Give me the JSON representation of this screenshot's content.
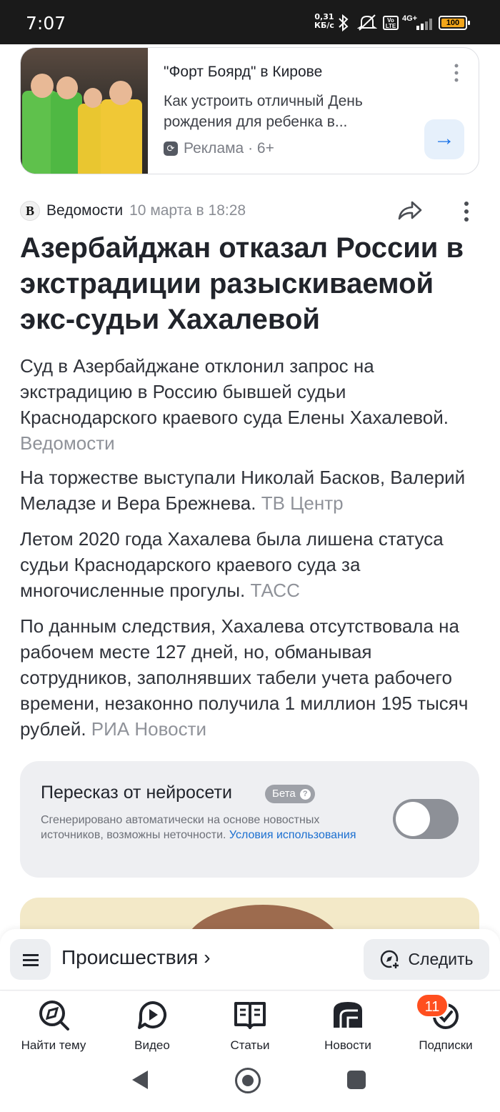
{
  "status_bar": {
    "time": "7:07",
    "rate_value": "0,31",
    "rate_unit": "КБ/с",
    "lte_label": "Vo LTE",
    "network": "4G+",
    "battery": "100",
    "battery_color": "#f2a51a"
  },
  "ad": {
    "title": "\"Форт Боярд\" в Кирове",
    "description": "Как устроить отличный День рождения для ребенка в...",
    "label": "Реклама · 6+",
    "arrow": "→"
  },
  "article": {
    "source_logo": "В",
    "source_name": "Ведомости",
    "date": "10 марта в 18:28",
    "headline": "Азербайджан отказал России в экстрадиции разыскиваемой экс-судьи Хахалевой",
    "paragraphs": [
      {
        "text": "Суд в Азербайджане отклонил запрос на экстрадицию в Россию бывшей судьи Краснодарского краевого суда Елены Хахалевой.",
        "source": "Ведомости"
      },
      {
        "text": "На торжестве выступали Николай Басков, Валерий Меладзе и Вера Брежнева.",
        "source": "ТВ Центр"
      },
      {
        "text": "Летом 2020 года Хахалева была лишена статуса судьи Краснодарского краевого суда за многочисленные прогулы.",
        "source": "ТАСС"
      },
      {
        "text": "По данным следствия, Хахалева отсутствовала на рабочем месте 127 дней, но, обманывая сотрудников, заполнявших табели учета рабочего времени, незаконно получила 1 миллион 195 тысяч рублей.",
        "source": "РИА Новости"
      }
    ]
  },
  "ai_summary": {
    "title": "Пересказ от нейросети",
    "beta": "Бета",
    "note": "Сгенерировано автоматически на основе новостных источников, возможны неточности.",
    "terms_link": "Условия использования",
    "toggle_on": false
  },
  "rubric": {
    "name": "Происшествия",
    "chevron": "›",
    "follow_label": "Следить"
  },
  "tabs": [
    {
      "label": "Найти тему",
      "icon": "compass-search-icon"
    },
    {
      "label": "Видео",
      "icon": "video-play-icon"
    },
    {
      "label": "Статьи",
      "icon": "book-icon"
    },
    {
      "label": "Новости",
      "icon": "news-icon"
    },
    {
      "label": "Подписки",
      "icon": "subscriptions-icon",
      "badge": "11"
    }
  ],
  "colors": {
    "accent_link": "#1b6fd0",
    "badge": "#ff4f1f",
    "arrow": "#1b73e8"
  }
}
